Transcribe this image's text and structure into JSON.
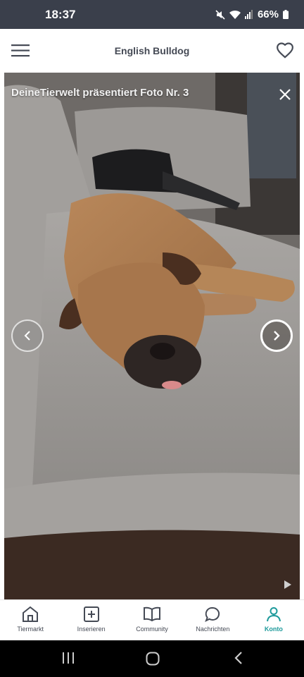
{
  "status": {
    "time": "18:37",
    "battery": "66%",
    "icons": [
      "mute-icon",
      "wifi-icon",
      "signal-icon",
      "battery-icon"
    ]
  },
  "header": {
    "title": "English Bulldog",
    "icons": {
      "menu": "hamburger-menu-icon",
      "favorite": "heart-icon"
    }
  },
  "viewer": {
    "caption": "DeineTierwelt präsentiert Foto Nr. 3",
    "icons": {
      "close": "close-icon",
      "prev": "chevron-left-icon",
      "next": "chevron-right-icon"
    }
  },
  "bottom_nav": {
    "active": "Konto",
    "items": [
      {
        "label": "Tiermarkt",
        "icon": "home-icon"
      },
      {
        "label": "Inserieren",
        "icon": "plus-square-icon"
      },
      {
        "label": "Community",
        "icon": "book-icon"
      },
      {
        "label": "Nachrichten",
        "icon": "chat-bubble-icon"
      },
      {
        "label": "Konto",
        "icon": "user-icon"
      }
    ]
  },
  "colors": {
    "status_bar": "#3a3f4b",
    "accent": "#1e9a9b",
    "text": "#454a55"
  }
}
